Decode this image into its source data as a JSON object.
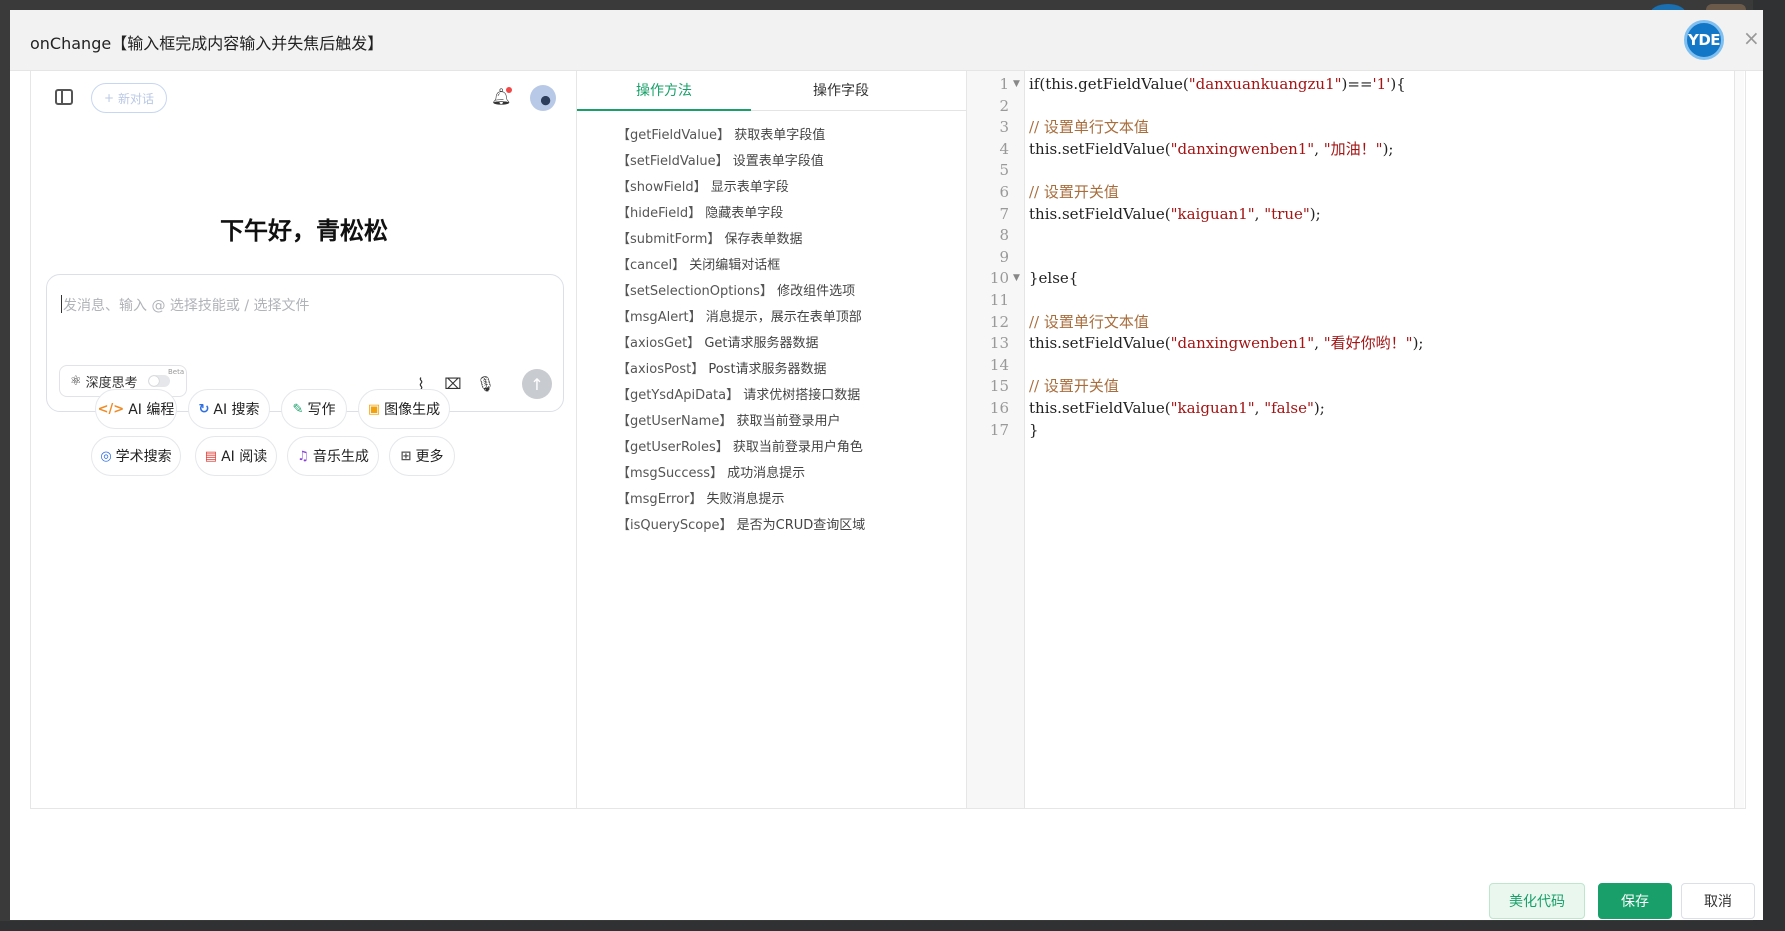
{
  "dialog": {
    "title": "onChange【输入框完成内容输入并失焦后触发】",
    "logo_text": "YDE",
    "close_label": "×"
  },
  "ai": {
    "new_chat_label": "新对话",
    "greeting": "下午好，青松松",
    "input_placeholder": "发消息、输入 @ 选择技能或 / 选择文件",
    "deep_think_label": "深度思考",
    "beta_label": "Beta",
    "chips": [
      {
        "icon": "code-icon",
        "glyph": "</>",
        "color": "#f08a24",
        "label": "AI 编程"
      },
      {
        "icon": "search-icon",
        "glyph": "↻",
        "color": "#2f6fe4",
        "label": "AI 搜索"
      },
      {
        "icon": "pen-icon",
        "glyph": "✎",
        "color": "#19a06a",
        "label": "写作"
      },
      {
        "icon": "image-icon",
        "glyph": "▣",
        "color": "#f2a20c",
        "label": "图像生成"
      },
      {
        "icon": "scholar-icon",
        "glyph": "◎",
        "color": "#2f6fe4",
        "label": "学术搜索"
      },
      {
        "icon": "read-icon",
        "glyph": "▤",
        "color": "#e0403a",
        "label": "AI 阅读"
      },
      {
        "icon": "music-icon",
        "glyph": "♫",
        "color": "#8b3fd9",
        "label": "音乐生成"
      },
      {
        "icon": "more-icon",
        "glyph": "⊞",
        "color": "#555555",
        "label": "更多"
      }
    ]
  },
  "methods": {
    "tabs": [
      "操作方法",
      "操作字段"
    ],
    "active_tab": 0,
    "items": [
      {
        "name": "【getFieldValue】",
        "desc": "获取表单字段值"
      },
      {
        "name": "【setFieldValue】",
        "desc": "设置表单字段值"
      },
      {
        "name": "【showField】",
        "desc": "显示表单字段"
      },
      {
        "name": "【hideField】",
        "desc": "隐藏表单字段"
      },
      {
        "name": "【submitForm】",
        "desc": "保存表单数据"
      },
      {
        "name": "【cancel】",
        "desc": "关闭编辑对话框"
      },
      {
        "name": "【setSelectionOptions】",
        "desc": "修改组件选项"
      },
      {
        "name": "【msgAlert】",
        "desc": "消息提示，展示在表单顶部"
      },
      {
        "name": "【axiosGet】",
        "desc": "Get请求服务器数据"
      },
      {
        "name": "【axiosPost】",
        "desc": "Post请求服务器数据"
      },
      {
        "name": "【getYsdApiData】",
        "desc": "请求优树搭接口数据"
      },
      {
        "name": "【getUserName】",
        "desc": "获取当前登录用户"
      },
      {
        "name": "【getUserRoles】",
        "desc": "获取当前登录用户角色"
      },
      {
        "name": "【msgSuccess】",
        "desc": "成功消息提示"
      },
      {
        "name": "【msgError】",
        "desc": "失败消息提示"
      },
      {
        "name": "【isQueryScope】",
        "desc": "是否为CRUD查询区域"
      }
    ]
  },
  "code": {
    "lines": [
      {
        "no": "1",
        "fold": true,
        "segs": [
          [
            "plain",
            "if(this.getFieldValue("
          ],
          [
            "str",
            "\"danxuankuangzu1\""
          ],
          [
            "plain",
            ")=="
          ],
          [
            "str",
            "'1'"
          ],
          [
            "plain",
            "){"
          ]
        ]
      },
      {
        "no": "2",
        "fold": false,
        "segs": []
      },
      {
        "no": "3",
        "fold": false,
        "segs": [
          [
            "com",
            "// 设置单行文本值"
          ]
        ]
      },
      {
        "no": "4",
        "fold": false,
        "segs": [
          [
            "plain",
            "this.setFieldValue("
          ],
          [
            "str",
            "\"danxingwenben1\""
          ],
          [
            "plain",
            ", "
          ],
          [
            "str",
            "\"加油！\""
          ],
          [
            "plain",
            ");"
          ]
        ]
      },
      {
        "no": "5",
        "fold": false,
        "segs": []
      },
      {
        "no": "6",
        "fold": false,
        "segs": [
          [
            "com",
            "// 设置开关值"
          ]
        ]
      },
      {
        "no": "7",
        "fold": false,
        "segs": [
          [
            "plain",
            "this.setFieldValue("
          ],
          [
            "str",
            "\"kaiguan1\""
          ],
          [
            "plain",
            ", "
          ],
          [
            "str",
            "\"true\""
          ],
          [
            "plain",
            ");"
          ]
        ]
      },
      {
        "no": "8",
        "fold": false,
        "segs": []
      },
      {
        "no": "9",
        "fold": false,
        "segs": []
      },
      {
        "no": "10",
        "fold": true,
        "segs": [
          [
            "plain",
            "}else{"
          ]
        ]
      },
      {
        "no": "11",
        "fold": false,
        "segs": []
      },
      {
        "no": "12",
        "fold": false,
        "segs": [
          [
            "com",
            "// 设置单行文本值"
          ]
        ]
      },
      {
        "no": "13",
        "fold": false,
        "segs": [
          [
            "plain",
            "this.setFieldValue("
          ],
          [
            "str",
            "\"danxingwenben1\""
          ],
          [
            "plain",
            ", "
          ],
          [
            "str",
            "\"看好你哟！\""
          ],
          [
            "plain",
            ");"
          ]
        ]
      },
      {
        "no": "14",
        "fold": false,
        "segs": []
      },
      {
        "no": "15",
        "fold": false,
        "segs": [
          [
            "com",
            "// 设置开关值"
          ]
        ]
      },
      {
        "no": "16",
        "fold": false,
        "segs": [
          [
            "plain",
            "this.setFieldValue("
          ],
          [
            "str",
            "\"kaiguan1\""
          ],
          [
            "plain",
            ", "
          ],
          [
            "str",
            "\"false\""
          ],
          [
            "plain",
            ");"
          ]
        ]
      },
      {
        "no": "17",
        "fold": false,
        "segs": [
          [
            "plain",
            "}"
          ]
        ]
      }
    ]
  },
  "footer": {
    "beautify_label": "美化代码",
    "save_label": "保存",
    "cancel_label": "取消"
  },
  "colors": {
    "accent": "#19a06a",
    "string": "#a31515",
    "comment": "#a86d3c"
  }
}
